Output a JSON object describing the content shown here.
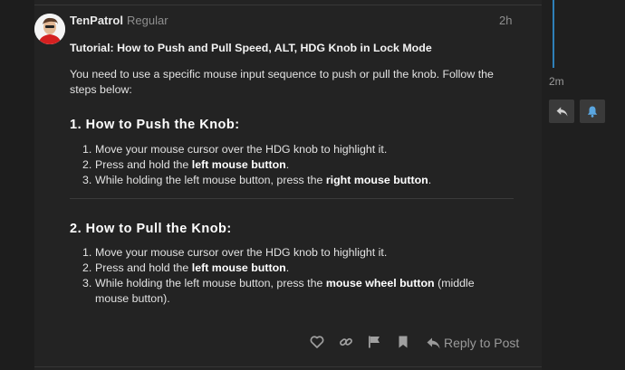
{
  "post": {
    "author_name": "TenPatrol",
    "author_title": "Regular",
    "date": "2h",
    "title": "Tutorial: How to Push and Pull Speed, ALT, HDG Knob in Lock Mode",
    "intro": "You need to use a specific mouse input sequence to push or pull the knob. Follow the steps below:",
    "section_push": {
      "heading": "1. How to Push the Knob:",
      "steps": [
        {
          "num": "1.",
          "text": "Move your mouse cursor over the HDG knob to highlight it."
        },
        {
          "num": "2.",
          "pre": "Press and hold the ",
          "bold": "left mouse button",
          "post": "."
        },
        {
          "num": "3.",
          "pre": "While holding the left mouse button, press the ",
          "bold": "right mouse button",
          "post": "."
        }
      ]
    },
    "section_pull": {
      "heading": "2. How to Pull the Knob:",
      "steps": [
        {
          "num": "1.",
          "text": "Move your mouse cursor over the HDG knob to highlight it."
        },
        {
          "num": "2.",
          "pre": "Press and hold the ",
          "bold": "left mouse button",
          "post": "."
        },
        {
          "num": "3.",
          "pre": "While holding the left mouse button, press the ",
          "bold": "mouse wheel button",
          "post": " (middle mouse button)."
        }
      ]
    },
    "actions": {
      "like_icon": "heart-icon",
      "link_icon": "link-icon",
      "flag_icon": "flag-icon",
      "bookmark_icon": "bookmark-icon",
      "reply_label": "Reply to Post"
    }
  },
  "timeline": {
    "date": "2m",
    "reply_icon": "reply-arrow-icon",
    "notify_icon": "bell-icon"
  },
  "colors": {
    "background": "#1f1f1f",
    "card": "#232323",
    "timeline_accent": "#2e7fb8",
    "muted_text": "#8f8f8f"
  }
}
